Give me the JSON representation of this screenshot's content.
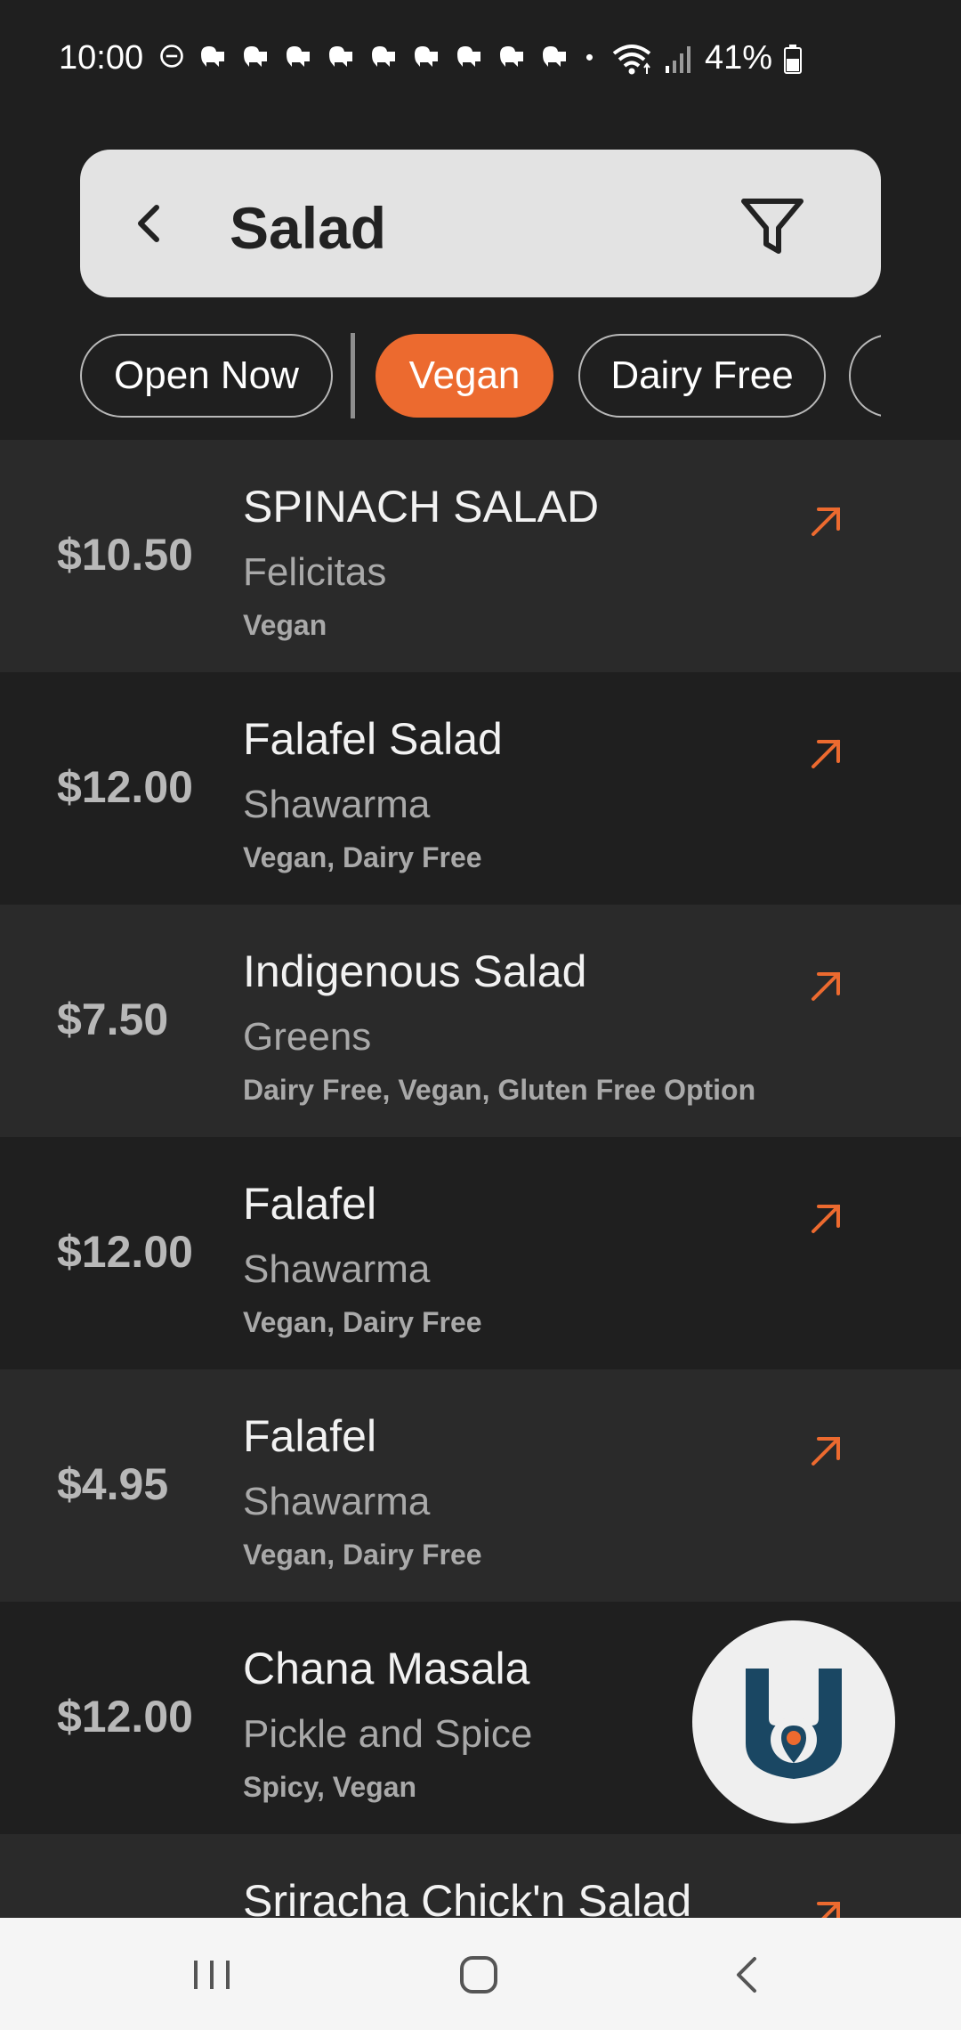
{
  "status_bar": {
    "time": "10:00",
    "battery": "41%",
    "icons": [
      "do-not-disturb-icon",
      "notification-icon",
      "wifi-icon",
      "signal-icon",
      "battery-icon"
    ]
  },
  "search": {
    "title": "Salad"
  },
  "filters": [
    {
      "label": "Open Now",
      "active": false
    },
    {
      "label": "Vegan",
      "active": true
    },
    {
      "label": "Dairy Free",
      "active": false
    }
  ],
  "items": [
    {
      "price": "$10.50",
      "name": "SPINACH SALAD",
      "place": "Felicitas",
      "tags": "Vegan"
    },
    {
      "price": "$12.00",
      "name": "Falafel Salad",
      "place": "Shawarma",
      "tags": "Vegan, Dairy Free"
    },
    {
      "price": "$7.50",
      "name": "Indigenous Salad",
      "place": "Greens",
      "tags": "Dairy Free, Vegan, Gluten Free Option"
    },
    {
      "price": "$12.00",
      "name": "Falafel",
      "place": "Shawarma",
      "tags": "Vegan, Dairy Free"
    },
    {
      "price": "$4.95",
      "name": "Falafel",
      "place": "Shawarma",
      "tags": "Vegan, Dairy Free"
    },
    {
      "price": "$12.00",
      "name": "Chana Masala",
      "place": "Pickle and Spice",
      "tags": "Spicy, Vegan"
    },
    {
      "price": "",
      "name": "Sriracha Chick'n Salad",
      "place": "",
      "tags": ""
    }
  ],
  "colors": {
    "accent": "#ec6a2f",
    "background": "#1f1f1f",
    "row_alt": "#2a2a2a",
    "logo": "#1a4763"
  }
}
